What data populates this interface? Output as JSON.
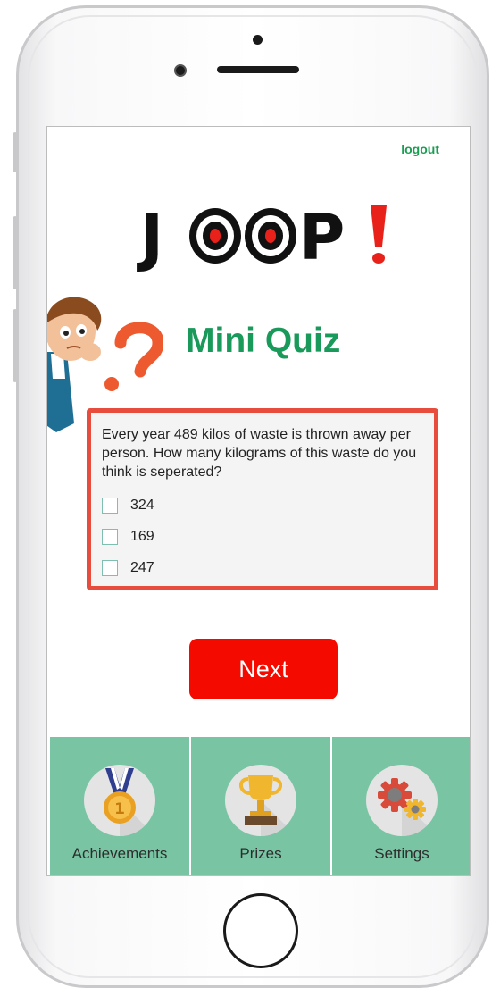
{
  "header": {
    "logout_label": "logout"
  },
  "logo": {
    "text": "JOOP!",
    "accent": "#e8221b"
  },
  "quiz": {
    "title": "Mini Quiz",
    "question": "Every year 489 kilos of waste is thrown away per person. How many kilograms of this waste do you think  is seperated?",
    "options": [
      "324",
      "169",
      "247"
    ]
  },
  "actions": {
    "next_label": "Next"
  },
  "nav": {
    "items": [
      {
        "label": "Achievements",
        "icon": "medal-icon"
      },
      {
        "label": "Prizes",
        "icon": "trophy-icon"
      },
      {
        "label": "Settings",
        "icon": "gears-icon"
      }
    ]
  },
  "colors": {
    "brand_green": "#19995a",
    "nav_green": "#79c5a3",
    "next_red": "#f50a00",
    "box_border": "#e84c3d"
  }
}
